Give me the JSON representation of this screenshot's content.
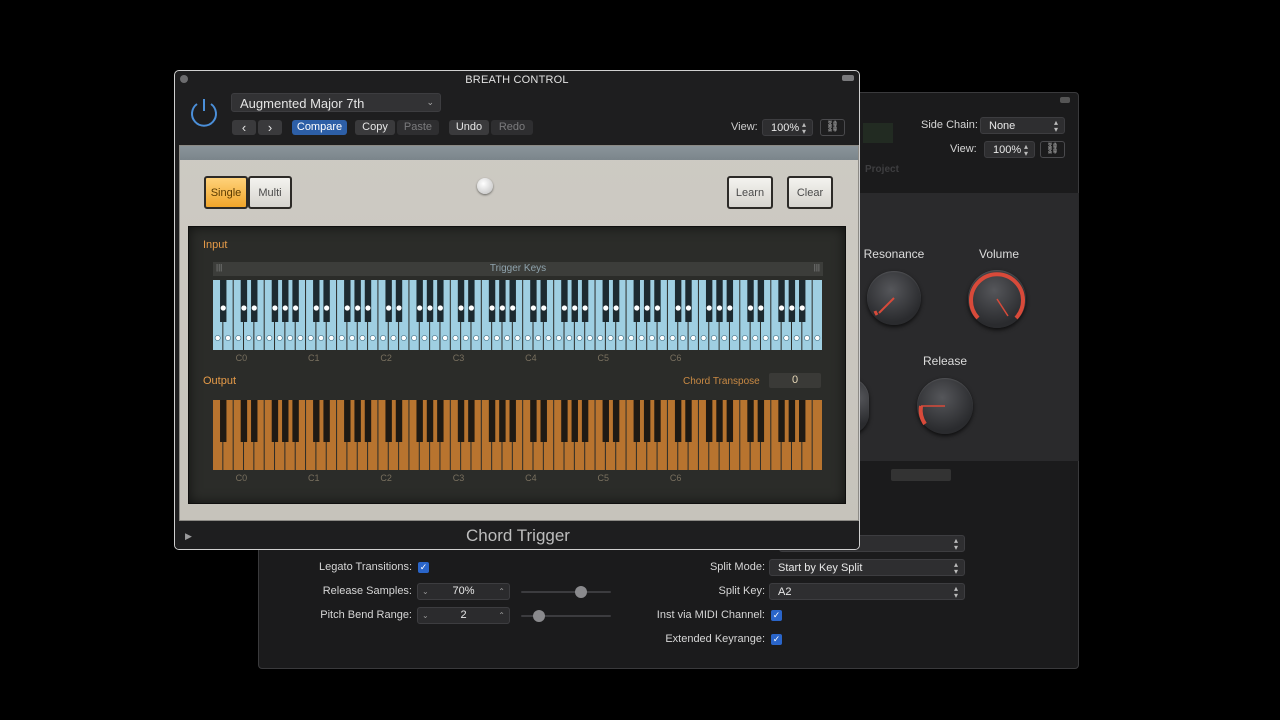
{
  "front": {
    "title": "BREATH CONTROL",
    "preset": "Augmented Major 7th",
    "nav_back": "‹",
    "nav_fwd": "›",
    "buttons": {
      "compare": "Compare",
      "copy": "Copy",
      "paste": "Paste",
      "undo": "Undo",
      "redo": "Redo"
    },
    "view_label": "View:",
    "view_value": "100%",
    "plugin_name": "Chord Trigger"
  },
  "plugin": {
    "single": "Single",
    "multi": "Multi",
    "learn": "Learn",
    "clear": "Clear",
    "input_label": "Input",
    "trigger_keys": "Trigger Keys",
    "output_label": "Output",
    "chord_transpose_label": "Chord Transpose",
    "chord_transpose_value": "0",
    "octave_labels": [
      "C0",
      "C1",
      "C2",
      "C3",
      "C4",
      "C5",
      "C6"
    ]
  },
  "back": {
    "side_chain_label": "Side Chain:",
    "side_chain_value": "None",
    "view_label": "View:",
    "view_value": "100%",
    "project_label": "Project",
    "knobs": {
      "resonance": "Resonance",
      "volume": "Volume",
      "release": "Release"
    },
    "legato_label": "Legato Transitions:",
    "release_samples_label": "Release Samples:",
    "release_samples_value": "70%",
    "release_samples_level": 0.7,
    "pitch_bend_label": "Pitch Bend Range:",
    "pitch_bend_value": "2",
    "split_mode_label": "Split Mode:",
    "split_mode_value": "Start by Key Split",
    "split_key_label": "Split Key:",
    "split_key_value": "A2",
    "inst_midi_label": "Inst via MIDI Channel:",
    "extended_keyrange_label": "Extended Keyrange:"
  },
  "colors": {
    "accent_blue": "#2d5fa7",
    "input_keys": "#9fcfe2",
    "output_keys": "#b8742f",
    "toggle_on": "#f0a52a",
    "knob_arc": "#d84a3a"
  }
}
